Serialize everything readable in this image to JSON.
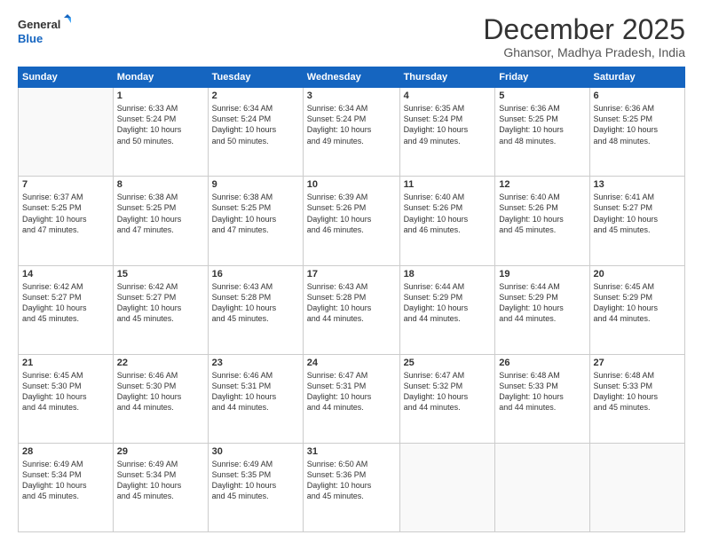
{
  "logo": {
    "line1": "General",
    "line2": "Blue"
  },
  "title": "December 2025",
  "subtitle": "Ghansor, Madhya Pradesh, India",
  "weekdays": [
    "Sunday",
    "Monday",
    "Tuesday",
    "Wednesday",
    "Thursday",
    "Friday",
    "Saturday"
  ],
  "weeks": [
    [
      {
        "day": "",
        "info": ""
      },
      {
        "day": "1",
        "info": "Sunrise: 6:33 AM\nSunset: 5:24 PM\nDaylight: 10 hours\nand 50 minutes."
      },
      {
        "day": "2",
        "info": "Sunrise: 6:34 AM\nSunset: 5:24 PM\nDaylight: 10 hours\nand 50 minutes."
      },
      {
        "day": "3",
        "info": "Sunrise: 6:34 AM\nSunset: 5:24 PM\nDaylight: 10 hours\nand 49 minutes."
      },
      {
        "day": "4",
        "info": "Sunrise: 6:35 AM\nSunset: 5:24 PM\nDaylight: 10 hours\nand 49 minutes."
      },
      {
        "day": "5",
        "info": "Sunrise: 6:36 AM\nSunset: 5:25 PM\nDaylight: 10 hours\nand 48 minutes."
      },
      {
        "day": "6",
        "info": "Sunrise: 6:36 AM\nSunset: 5:25 PM\nDaylight: 10 hours\nand 48 minutes."
      }
    ],
    [
      {
        "day": "7",
        "info": "Sunrise: 6:37 AM\nSunset: 5:25 PM\nDaylight: 10 hours\nand 47 minutes."
      },
      {
        "day": "8",
        "info": "Sunrise: 6:38 AM\nSunset: 5:25 PM\nDaylight: 10 hours\nand 47 minutes."
      },
      {
        "day": "9",
        "info": "Sunrise: 6:38 AM\nSunset: 5:25 PM\nDaylight: 10 hours\nand 47 minutes."
      },
      {
        "day": "10",
        "info": "Sunrise: 6:39 AM\nSunset: 5:26 PM\nDaylight: 10 hours\nand 46 minutes."
      },
      {
        "day": "11",
        "info": "Sunrise: 6:40 AM\nSunset: 5:26 PM\nDaylight: 10 hours\nand 46 minutes."
      },
      {
        "day": "12",
        "info": "Sunrise: 6:40 AM\nSunset: 5:26 PM\nDaylight: 10 hours\nand 45 minutes."
      },
      {
        "day": "13",
        "info": "Sunrise: 6:41 AM\nSunset: 5:27 PM\nDaylight: 10 hours\nand 45 minutes."
      }
    ],
    [
      {
        "day": "14",
        "info": "Sunrise: 6:42 AM\nSunset: 5:27 PM\nDaylight: 10 hours\nand 45 minutes."
      },
      {
        "day": "15",
        "info": "Sunrise: 6:42 AM\nSunset: 5:27 PM\nDaylight: 10 hours\nand 45 minutes."
      },
      {
        "day": "16",
        "info": "Sunrise: 6:43 AM\nSunset: 5:28 PM\nDaylight: 10 hours\nand 45 minutes."
      },
      {
        "day": "17",
        "info": "Sunrise: 6:43 AM\nSunset: 5:28 PM\nDaylight: 10 hours\nand 44 minutes."
      },
      {
        "day": "18",
        "info": "Sunrise: 6:44 AM\nSunset: 5:29 PM\nDaylight: 10 hours\nand 44 minutes."
      },
      {
        "day": "19",
        "info": "Sunrise: 6:44 AM\nSunset: 5:29 PM\nDaylight: 10 hours\nand 44 minutes."
      },
      {
        "day": "20",
        "info": "Sunrise: 6:45 AM\nSunset: 5:29 PM\nDaylight: 10 hours\nand 44 minutes."
      }
    ],
    [
      {
        "day": "21",
        "info": "Sunrise: 6:45 AM\nSunset: 5:30 PM\nDaylight: 10 hours\nand 44 minutes."
      },
      {
        "day": "22",
        "info": "Sunrise: 6:46 AM\nSunset: 5:30 PM\nDaylight: 10 hours\nand 44 minutes."
      },
      {
        "day": "23",
        "info": "Sunrise: 6:46 AM\nSunset: 5:31 PM\nDaylight: 10 hours\nand 44 minutes."
      },
      {
        "day": "24",
        "info": "Sunrise: 6:47 AM\nSunset: 5:31 PM\nDaylight: 10 hours\nand 44 minutes."
      },
      {
        "day": "25",
        "info": "Sunrise: 6:47 AM\nSunset: 5:32 PM\nDaylight: 10 hours\nand 44 minutes."
      },
      {
        "day": "26",
        "info": "Sunrise: 6:48 AM\nSunset: 5:33 PM\nDaylight: 10 hours\nand 44 minutes."
      },
      {
        "day": "27",
        "info": "Sunrise: 6:48 AM\nSunset: 5:33 PM\nDaylight: 10 hours\nand 45 minutes."
      }
    ],
    [
      {
        "day": "28",
        "info": "Sunrise: 6:49 AM\nSunset: 5:34 PM\nDaylight: 10 hours\nand 45 minutes."
      },
      {
        "day": "29",
        "info": "Sunrise: 6:49 AM\nSunset: 5:34 PM\nDaylight: 10 hours\nand 45 minutes."
      },
      {
        "day": "30",
        "info": "Sunrise: 6:49 AM\nSunset: 5:35 PM\nDaylight: 10 hours\nand 45 minutes."
      },
      {
        "day": "31",
        "info": "Sunrise: 6:50 AM\nSunset: 5:36 PM\nDaylight: 10 hours\nand 45 minutes."
      },
      {
        "day": "",
        "info": ""
      },
      {
        "day": "",
        "info": ""
      },
      {
        "day": "",
        "info": ""
      }
    ]
  ]
}
